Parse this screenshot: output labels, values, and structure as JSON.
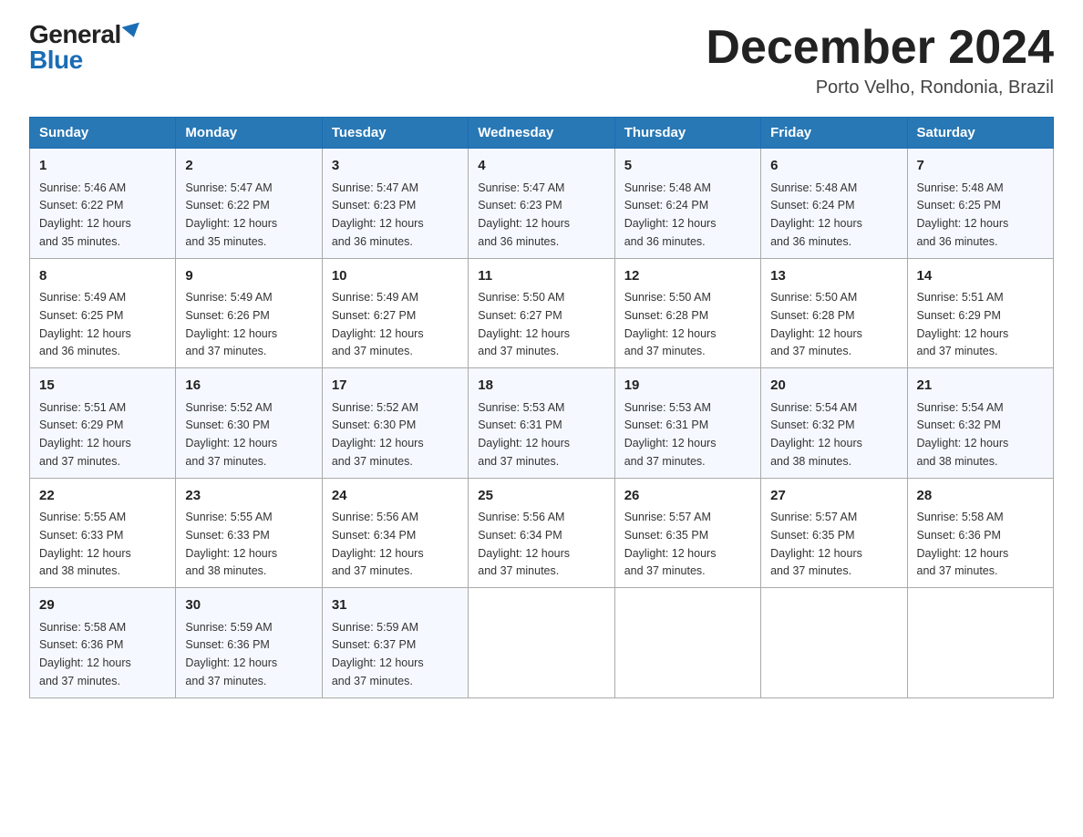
{
  "logo": {
    "general": "General",
    "blue": "Blue"
  },
  "header": {
    "title": "December 2024",
    "location": "Porto Velho, Rondonia, Brazil"
  },
  "weekdays": [
    "Sunday",
    "Monday",
    "Tuesday",
    "Wednesday",
    "Thursday",
    "Friday",
    "Saturday"
  ],
  "weeks": [
    [
      {
        "day": "1",
        "sunrise": "5:46 AM",
        "sunset": "6:22 PM",
        "daylight": "12 hours and 35 minutes."
      },
      {
        "day": "2",
        "sunrise": "5:47 AM",
        "sunset": "6:22 PM",
        "daylight": "12 hours and 35 minutes."
      },
      {
        "day": "3",
        "sunrise": "5:47 AM",
        "sunset": "6:23 PM",
        "daylight": "12 hours and 36 minutes."
      },
      {
        "day": "4",
        "sunrise": "5:47 AM",
        "sunset": "6:23 PM",
        "daylight": "12 hours and 36 minutes."
      },
      {
        "day": "5",
        "sunrise": "5:48 AM",
        "sunset": "6:24 PM",
        "daylight": "12 hours and 36 minutes."
      },
      {
        "day": "6",
        "sunrise": "5:48 AM",
        "sunset": "6:24 PM",
        "daylight": "12 hours and 36 minutes."
      },
      {
        "day": "7",
        "sunrise": "5:48 AM",
        "sunset": "6:25 PM",
        "daylight": "12 hours and 36 minutes."
      }
    ],
    [
      {
        "day": "8",
        "sunrise": "5:49 AM",
        "sunset": "6:25 PM",
        "daylight": "12 hours and 36 minutes."
      },
      {
        "day": "9",
        "sunrise": "5:49 AM",
        "sunset": "6:26 PM",
        "daylight": "12 hours and 37 minutes."
      },
      {
        "day": "10",
        "sunrise": "5:49 AM",
        "sunset": "6:27 PM",
        "daylight": "12 hours and 37 minutes."
      },
      {
        "day": "11",
        "sunrise": "5:50 AM",
        "sunset": "6:27 PM",
        "daylight": "12 hours and 37 minutes."
      },
      {
        "day": "12",
        "sunrise": "5:50 AM",
        "sunset": "6:28 PM",
        "daylight": "12 hours and 37 minutes."
      },
      {
        "day": "13",
        "sunrise": "5:50 AM",
        "sunset": "6:28 PM",
        "daylight": "12 hours and 37 minutes."
      },
      {
        "day": "14",
        "sunrise": "5:51 AM",
        "sunset": "6:29 PM",
        "daylight": "12 hours and 37 minutes."
      }
    ],
    [
      {
        "day": "15",
        "sunrise": "5:51 AM",
        "sunset": "6:29 PM",
        "daylight": "12 hours and 37 minutes."
      },
      {
        "day": "16",
        "sunrise": "5:52 AM",
        "sunset": "6:30 PM",
        "daylight": "12 hours and 37 minutes."
      },
      {
        "day": "17",
        "sunrise": "5:52 AM",
        "sunset": "6:30 PM",
        "daylight": "12 hours and 37 minutes."
      },
      {
        "day": "18",
        "sunrise": "5:53 AM",
        "sunset": "6:31 PM",
        "daylight": "12 hours and 37 minutes."
      },
      {
        "day": "19",
        "sunrise": "5:53 AM",
        "sunset": "6:31 PM",
        "daylight": "12 hours and 37 minutes."
      },
      {
        "day": "20",
        "sunrise": "5:54 AM",
        "sunset": "6:32 PM",
        "daylight": "12 hours and 38 minutes."
      },
      {
        "day": "21",
        "sunrise": "5:54 AM",
        "sunset": "6:32 PM",
        "daylight": "12 hours and 38 minutes."
      }
    ],
    [
      {
        "day": "22",
        "sunrise": "5:55 AM",
        "sunset": "6:33 PM",
        "daylight": "12 hours and 38 minutes."
      },
      {
        "day": "23",
        "sunrise": "5:55 AM",
        "sunset": "6:33 PM",
        "daylight": "12 hours and 38 minutes."
      },
      {
        "day": "24",
        "sunrise": "5:56 AM",
        "sunset": "6:34 PM",
        "daylight": "12 hours and 37 minutes."
      },
      {
        "day": "25",
        "sunrise": "5:56 AM",
        "sunset": "6:34 PM",
        "daylight": "12 hours and 37 minutes."
      },
      {
        "day": "26",
        "sunrise": "5:57 AM",
        "sunset": "6:35 PM",
        "daylight": "12 hours and 37 minutes."
      },
      {
        "day": "27",
        "sunrise": "5:57 AM",
        "sunset": "6:35 PM",
        "daylight": "12 hours and 37 minutes."
      },
      {
        "day": "28",
        "sunrise": "5:58 AM",
        "sunset": "6:36 PM",
        "daylight": "12 hours and 37 minutes."
      }
    ],
    [
      {
        "day": "29",
        "sunrise": "5:58 AM",
        "sunset": "6:36 PM",
        "daylight": "12 hours and 37 minutes."
      },
      {
        "day": "30",
        "sunrise": "5:59 AM",
        "sunset": "6:36 PM",
        "daylight": "12 hours and 37 minutes."
      },
      {
        "day": "31",
        "sunrise": "5:59 AM",
        "sunset": "6:37 PM",
        "daylight": "12 hours and 37 minutes."
      },
      null,
      null,
      null,
      null
    ]
  ],
  "labels": {
    "sunrise": "Sunrise:",
    "sunset": "Sunset:",
    "daylight": "Daylight:"
  }
}
